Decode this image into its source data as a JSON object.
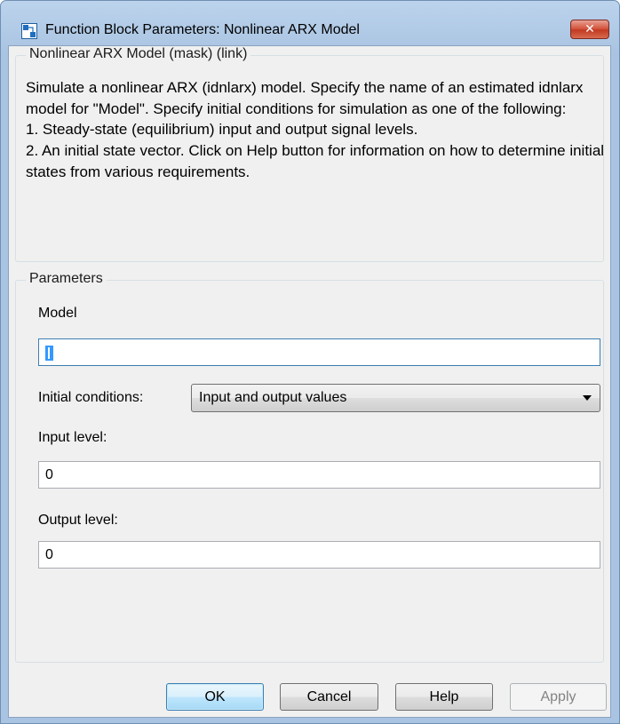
{
  "window": {
    "title": "Function Block Parameters: Nonlinear ARX Model",
    "icon": "simulink-block-icon",
    "close_label": "✕"
  },
  "mask": {
    "legend": "Nonlinear ARX Model (mask) (link)",
    "description": [
      "Simulate a nonlinear ARX (idnlarx) model. Specify the name of an estimated idnlarx model for \"Model\". Specify initial conditions for simulation as one of the following:",
      "1. Steady-state (equilibrium) input and output signal levels.",
      "2. An initial state vector. Click on Help button for information on how to determine initial states from various requirements."
    ]
  },
  "parameters": {
    "legend": "Parameters",
    "model_label": "Model",
    "model_value": "",
    "initial_conditions_label": "Initial conditions:",
    "initial_conditions_value": "Input and output values",
    "input_level_label": "Input level:",
    "input_level_value": "0",
    "output_level_label": "Output level:",
    "output_level_value": "0"
  },
  "buttons": {
    "ok": "OK",
    "cancel": "Cancel",
    "help": "Help",
    "apply": "Apply"
  },
  "colors": {
    "title_bar": "#a9c4e2",
    "close_button": "#c23a21",
    "dialog_background": "#f0f0f0",
    "default_button": "#bee6fd",
    "selection": "#3399ff"
  }
}
